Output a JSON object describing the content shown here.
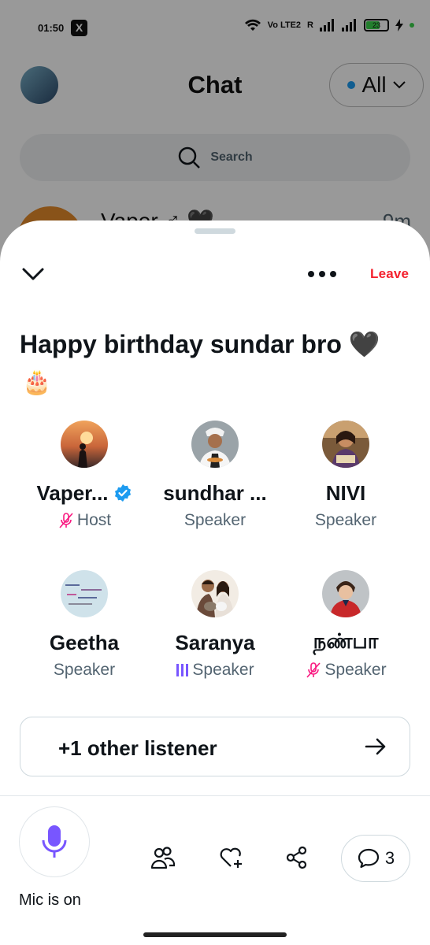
{
  "status_bar": {
    "time": "01:50",
    "x_badge": "X",
    "network": "Vo LTE2",
    "roaming": "R",
    "battery": "23"
  },
  "background": {
    "title": "Chat",
    "filter_label": "All",
    "search_placeholder": "Search",
    "row_name": "Vaper ♂ 🖤",
    "row_time": "9m"
  },
  "space": {
    "leave_label": "Leave",
    "title": "Happy birthday sundar bro 🖤",
    "title_emoji": "🎂",
    "participants": [
      {
        "name": "Vaper...",
        "role": "Host",
        "verified": true,
        "muted": true,
        "speaking": false
      },
      {
        "name": "sundhar ...",
        "role": "Speaker",
        "verified": false,
        "muted": false,
        "speaking": false
      },
      {
        "name": "NIVI",
        "role": "Speaker",
        "verified": false,
        "muted": false,
        "speaking": false
      },
      {
        "name": "Geetha",
        "role": "Speaker",
        "verified": false,
        "muted": false,
        "speaking": false
      },
      {
        "name": "Saranya",
        "role": "Speaker",
        "verified": false,
        "muted": false,
        "speaking": true
      },
      {
        "name": "நண்பா",
        "role": "Speaker",
        "verified": false,
        "muted": true,
        "speaking": false
      }
    ],
    "listener_label": "+1 other listener",
    "mic_label": "Mic is on",
    "comments_count": "3"
  },
  "colors": {
    "accent": "#1d9bf0",
    "mic": "#7856ff",
    "leave": "#f4212e",
    "muted": "#f91880"
  }
}
